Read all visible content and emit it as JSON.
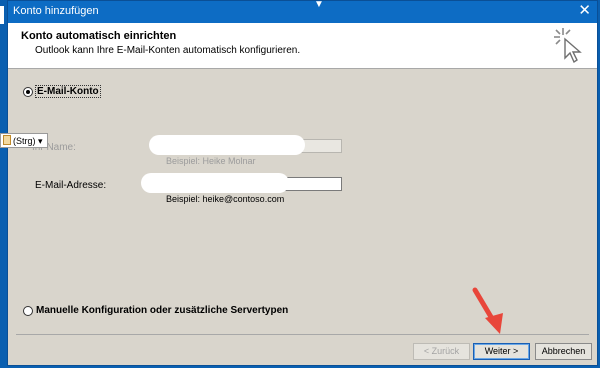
{
  "window": {
    "title": "Konto hinzufügen",
    "close_glyph": "✕"
  },
  "header": {
    "title": "Konto automatisch einrichten",
    "subtitle": "Outlook kann Ihre E-Mail-Konten automatisch konfigurieren.",
    "icon": "wizard-sparkle-cursor-icon"
  },
  "options": {
    "email_account_label": "E-Mail-Konto",
    "email_account_selected": true,
    "manual_label": "Manuelle Konfiguration oder zusätzliche Servertypen",
    "manual_selected": false
  },
  "form": {
    "name_label": "Ihr Name:",
    "name_hint": "Beispiel: Heike Molnar",
    "email_label": "E-Mail-Adresse:",
    "email_hint": "Beispiel: heike@contoso.com"
  },
  "paste_tag": {
    "label": "(Strg) ▾",
    "icon": "clipboard-icon"
  },
  "buttons": {
    "back": "< Zurück",
    "next": "Weiter >",
    "cancel": "Abbrechen"
  },
  "colors": {
    "titlebar": "#0d6cc4",
    "dialog_bg": "#d9d5cc",
    "arrow": "#e8463a"
  }
}
